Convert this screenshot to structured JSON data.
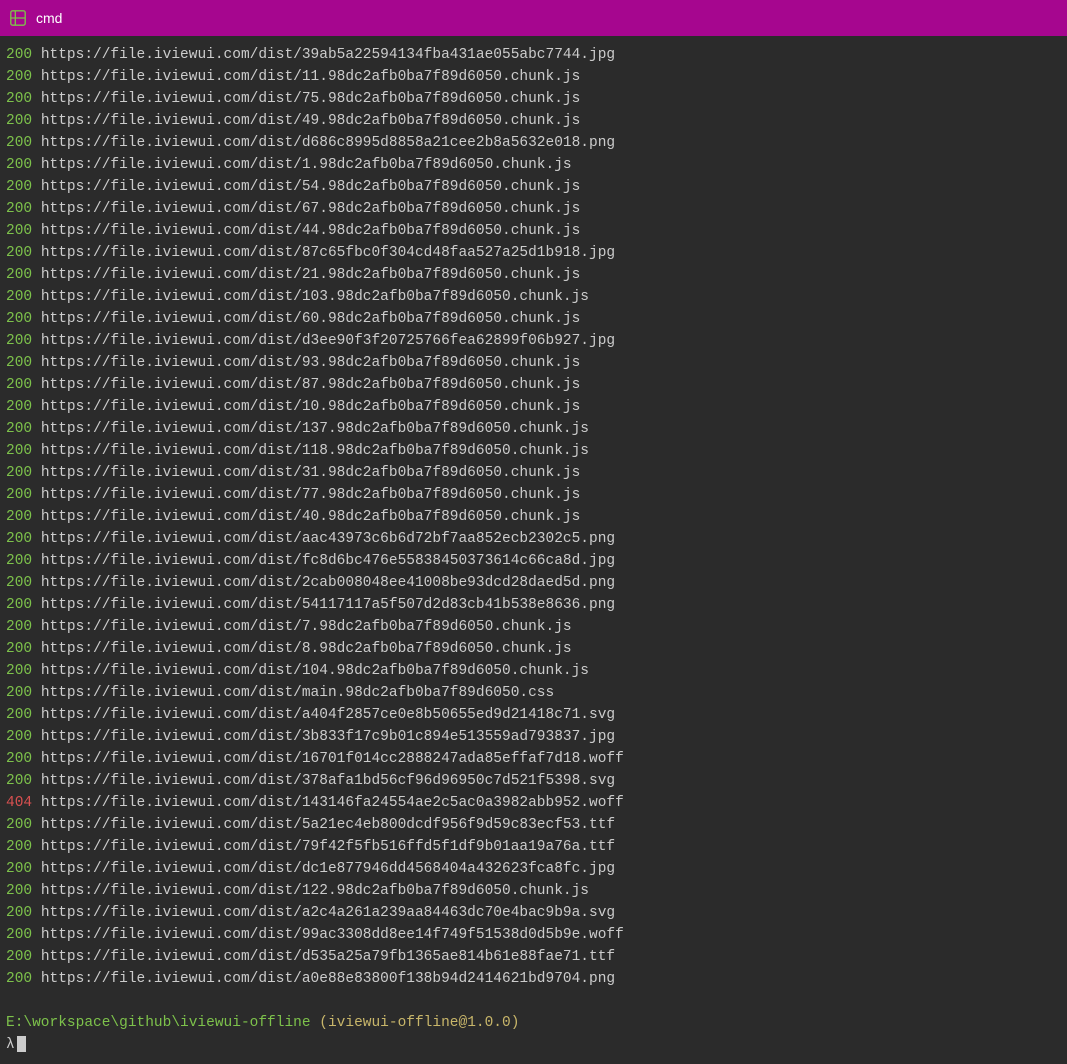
{
  "titlebar": {
    "title": "cmd"
  },
  "logs": [
    {
      "status": "200",
      "url": "https://file.iviewui.com/dist/39ab5a22594134fba431ae055abc7744.jpg"
    },
    {
      "status": "200",
      "url": "https://file.iviewui.com/dist/11.98dc2afb0ba7f89d6050.chunk.js"
    },
    {
      "status": "200",
      "url": "https://file.iviewui.com/dist/75.98dc2afb0ba7f89d6050.chunk.js"
    },
    {
      "status": "200",
      "url": "https://file.iviewui.com/dist/49.98dc2afb0ba7f89d6050.chunk.js"
    },
    {
      "status": "200",
      "url": "https://file.iviewui.com/dist/d686c8995d8858a21cee2b8a5632e018.png"
    },
    {
      "status": "200",
      "url": "https://file.iviewui.com/dist/1.98dc2afb0ba7f89d6050.chunk.js"
    },
    {
      "status": "200",
      "url": "https://file.iviewui.com/dist/54.98dc2afb0ba7f89d6050.chunk.js"
    },
    {
      "status": "200",
      "url": "https://file.iviewui.com/dist/67.98dc2afb0ba7f89d6050.chunk.js"
    },
    {
      "status": "200",
      "url": "https://file.iviewui.com/dist/44.98dc2afb0ba7f89d6050.chunk.js"
    },
    {
      "status": "200",
      "url": "https://file.iviewui.com/dist/87c65fbc0f304cd48faa527a25d1b918.jpg"
    },
    {
      "status": "200",
      "url": "https://file.iviewui.com/dist/21.98dc2afb0ba7f89d6050.chunk.js"
    },
    {
      "status": "200",
      "url": "https://file.iviewui.com/dist/103.98dc2afb0ba7f89d6050.chunk.js"
    },
    {
      "status": "200",
      "url": "https://file.iviewui.com/dist/60.98dc2afb0ba7f89d6050.chunk.js"
    },
    {
      "status": "200",
      "url": "https://file.iviewui.com/dist/d3ee90f3f20725766fea62899f06b927.jpg"
    },
    {
      "status": "200",
      "url": "https://file.iviewui.com/dist/93.98dc2afb0ba7f89d6050.chunk.js"
    },
    {
      "status": "200",
      "url": "https://file.iviewui.com/dist/87.98dc2afb0ba7f89d6050.chunk.js"
    },
    {
      "status": "200",
      "url": "https://file.iviewui.com/dist/10.98dc2afb0ba7f89d6050.chunk.js"
    },
    {
      "status": "200",
      "url": "https://file.iviewui.com/dist/137.98dc2afb0ba7f89d6050.chunk.js"
    },
    {
      "status": "200",
      "url": "https://file.iviewui.com/dist/118.98dc2afb0ba7f89d6050.chunk.js"
    },
    {
      "status": "200",
      "url": "https://file.iviewui.com/dist/31.98dc2afb0ba7f89d6050.chunk.js"
    },
    {
      "status": "200",
      "url": "https://file.iviewui.com/dist/77.98dc2afb0ba7f89d6050.chunk.js"
    },
    {
      "status": "200",
      "url": "https://file.iviewui.com/dist/40.98dc2afb0ba7f89d6050.chunk.js"
    },
    {
      "status": "200",
      "url": "https://file.iviewui.com/dist/aac43973c6b6d72bf7aa852ecb2302c5.png"
    },
    {
      "status": "200",
      "url": "https://file.iviewui.com/dist/fc8d6bc476e55838450373614c66ca8d.jpg"
    },
    {
      "status": "200",
      "url": "https://file.iviewui.com/dist/2cab008048ee41008be93dcd28daed5d.png"
    },
    {
      "status": "200",
      "url": "https://file.iviewui.com/dist/54117117a5f507d2d83cb41b538e8636.png"
    },
    {
      "status": "200",
      "url": "https://file.iviewui.com/dist/7.98dc2afb0ba7f89d6050.chunk.js"
    },
    {
      "status": "200",
      "url": "https://file.iviewui.com/dist/8.98dc2afb0ba7f89d6050.chunk.js"
    },
    {
      "status": "200",
      "url": "https://file.iviewui.com/dist/104.98dc2afb0ba7f89d6050.chunk.js"
    },
    {
      "status": "200",
      "url": "https://file.iviewui.com/dist/main.98dc2afb0ba7f89d6050.css"
    },
    {
      "status": "200",
      "url": "https://file.iviewui.com/dist/a404f2857ce0e8b50655ed9d21418c71.svg"
    },
    {
      "status": "200",
      "url": "https://file.iviewui.com/dist/3b833f17c9b01c894e513559ad793837.jpg"
    },
    {
      "status": "200",
      "url": "https://file.iviewui.com/dist/16701f014cc2888247ada85effaf7d18.woff"
    },
    {
      "status": "200",
      "url": "https://file.iviewui.com/dist/378afa1bd56cf96d96950c7d521f5398.svg"
    },
    {
      "status": "404",
      "url": "https://file.iviewui.com/dist/143146fa24554ae2c5ac0a3982abb952.woff"
    },
    {
      "status": "200",
      "url": "https://file.iviewui.com/dist/5a21ec4eb800dcdf956f9d59c83ecf53.ttf"
    },
    {
      "status": "200",
      "url": "https://file.iviewui.com/dist/79f42f5fb516ffd5f1df9b01aa19a76a.ttf"
    },
    {
      "status": "200",
      "url": "https://file.iviewui.com/dist/dc1e877946dd4568404a432623fca8fc.jpg"
    },
    {
      "status": "200",
      "url": "https://file.iviewui.com/dist/122.98dc2afb0ba7f89d6050.chunk.js"
    },
    {
      "status": "200",
      "url": "https://file.iviewui.com/dist/a2c4a261a239aa84463dc70e4bac9b9a.svg"
    },
    {
      "status": "200",
      "url": "https://file.iviewui.com/dist/99ac3308dd8ee14f749f51538d0d5b9e.woff"
    },
    {
      "status": "200",
      "url": "https://file.iviewui.com/dist/d535a25a79fb1365ae814b61e88fae71.ttf"
    },
    {
      "status": "200",
      "url": "https://file.iviewui.com/dist/a0e88e83800f138b94d2414621bd9704.png"
    }
  ],
  "prompt": {
    "path": "E:\\workspace\\github\\iviewui-offline",
    "package": "(iviewui-offline@1.0.0)",
    "symbol": "λ"
  }
}
